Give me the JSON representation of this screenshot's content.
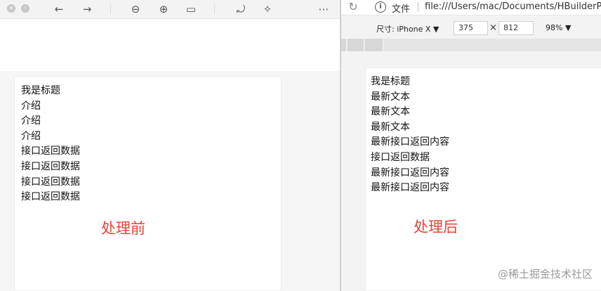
{
  "left_window": {
    "toolbar": {
      "close_glyph": "×",
      "minimize_glyph": "◦",
      "icons": [
        {
          "name": "back-icon",
          "glyph": "←"
        },
        {
          "name": "forward-icon",
          "glyph": "→"
        },
        {
          "name": "zoom-out-icon",
          "glyph": "⊖"
        },
        {
          "name": "zoom-in-icon",
          "glyph": "⊕"
        },
        {
          "name": "fit-width-icon",
          "glyph": "▭"
        },
        {
          "name": "rotate-icon",
          "glyph": "⤾"
        },
        {
          "name": "magic-wand-icon",
          "glyph": "✧"
        },
        {
          "name": "more-icon",
          "glyph": "⋯"
        }
      ]
    },
    "content_lines": [
      "我是标题",
      "介绍",
      "介绍",
      "介绍",
      "接口返回数据",
      "接口返回数据",
      "接口返回数据",
      "接口返回数据"
    ],
    "stamp": "处理前"
  },
  "right_window": {
    "address_bar": {
      "reload_glyph": "↻",
      "info_glyph": "i",
      "file_label": "文件",
      "url": "file:///Users/mac/Documents/HBuilderP"
    },
    "devtools": {
      "device_label": "尺寸: iPhone X ▼",
      "width": "375",
      "height": "812",
      "times": "×",
      "zoom": "98% ▼"
    },
    "content_lines": [
      "我是标题",
      "最新文本",
      "最新文本",
      "最新文本",
      "最新接口返回内容",
      "接口返回数据",
      "最新接口返回内容",
      "最新接口返回内容"
    ],
    "stamp": "处理后"
  },
  "watermark": "@稀土掘金技术社区",
  "colors": {
    "stamp_red": "#e64335",
    "text": "#111111",
    "watermark": "#9a9a9a"
  }
}
